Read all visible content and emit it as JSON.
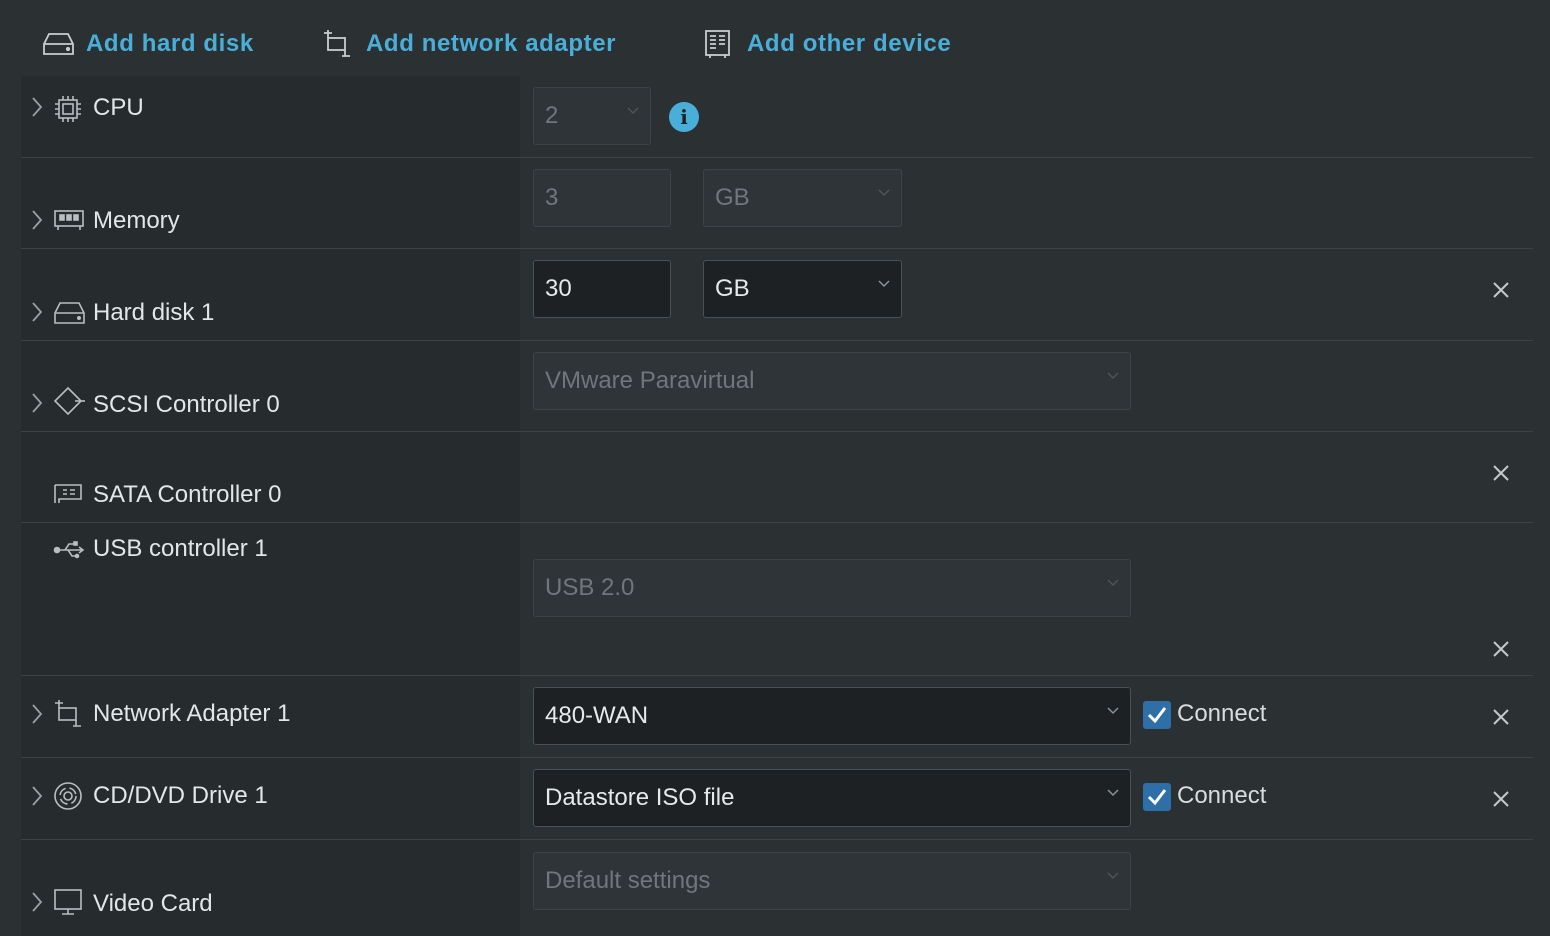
{
  "toolbar": {
    "add_hard_disk": "Add hard disk",
    "add_network_adapter": "Add network adapter",
    "add_other_device": "Add other device"
  },
  "devices": {
    "cpu": {
      "label": "CPU",
      "value": "2"
    },
    "memory": {
      "label": "Memory",
      "value": "3",
      "unit": "GB"
    },
    "hard_disk": {
      "label": "Hard disk 1",
      "value": "30",
      "unit": "GB"
    },
    "scsi": {
      "label": "SCSI Controller 0",
      "type": "VMware Paravirtual"
    },
    "sata": {
      "label": "SATA Controller 0"
    },
    "usb": {
      "label": "USB controller 1",
      "type": "USB 2.0"
    },
    "network": {
      "label": "Network Adapter 1",
      "value": "480-WAN",
      "connect_label": "Connect",
      "connected": true
    },
    "cddvd": {
      "label": "CD/DVD Drive 1",
      "value": "Datastore ISO file",
      "connect_label": "Connect",
      "connected": true
    },
    "video": {
      "label": "Video Card",
      "value": "Default settings"
    }
  },
  "colors": {
    "accent": "#49afd9",
    "checkbox": "#2e6fa8",
    "background": "#2b3033",
    "label_column": "#262b2e"
  },
  "icons": {
    "toolbar": [
      "hard-disk-icon",
      "network-adapter-icon",
      "other-device-icon"
    ],
    "devices": [
      "cpu-icon",
      "memory-icon",
      "hard-disk-icon",
      "scsi-controller-icon",
      "sata-controller-icon",
      "usb-icon",
      "network-adapter-icon",
      "cd-dvd-icon",
      "monitor-icon"
    ]
  }
}
